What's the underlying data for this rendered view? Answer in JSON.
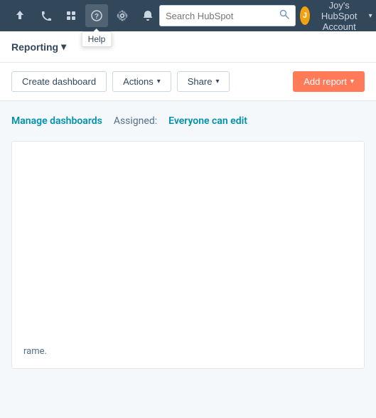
{
  "topNav": {
    "icons": [
      {
        "name": "upload-icon",
        "symbol": "⬆"
      },
      {
        "name": "phone-icon",
        "symbol": "📞"
      },
      {
        "name": "store-icon",
        "symbol": "🏪"
      },
      {
        "name": "help-icon",
        "symbol": "?"
      },
      {
        "name": "settings-icon",
        "symbol": "⚙"
      },
      {
        "name": "notifications-icon",
        "symbol": "🔔"
      }
    ],
    "helpTooltip": "Help",
    "search": {
      "placeholder": "Search HubSpot"
    },
    "account": {
      "name": "Joy's HubSpot Account",
      "avatarInitials": "J"
    }
  },
  "secondaryNav": {
    "reportingLabel": "Reporting",
    "chevron": "▾"
  },
  "toolbar": {
    "createDashboardLabel": "Create dashboard",
    "actionsLabel": "Actions",
    "shareLabel": "Share",
    "addReportLabel": "Add report",
    "dropdownCaret": "▾"
  },
  "main": {
    "manageDashboardsLabel": "Manage dashboards",
    "assignedLabel": "Assigned:",
    "assignedValue": "Everyone can edit",
    "frameText": "rame."
  }
}
